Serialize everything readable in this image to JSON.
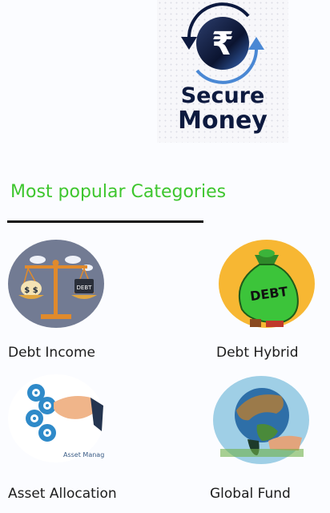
{
  "logo": {
    "currency_symbol": "₹",
    "line1": "Secure",
    "line2": "Money",
    "colors": {
      "navy": "#0d1a3f",
      "blue": "#4a88d4"
    }
  },
  "section": {
    "title": "Most popular Categories",
    "title_color": "#3ec62e"
  },
  "categories": [
    {
      "label": "Debt Income",
      "icon": "balance-scale-icon",
      "art_text": "DEBT"
    },
    {
      "label": "Debt Hybrid",
      "icon": "debt-bag-icon",
      "art_text": "DEBT"
    },
    {
      "label": "Asset Allocation",
      "icon": "gears-hand-icon",
      "art_text": "Asset Manag"
    },
    {
      "label": "Global Fund",
      "icon": "globe-hand-icon",
      "art_text": ""
    }
  ]
}
